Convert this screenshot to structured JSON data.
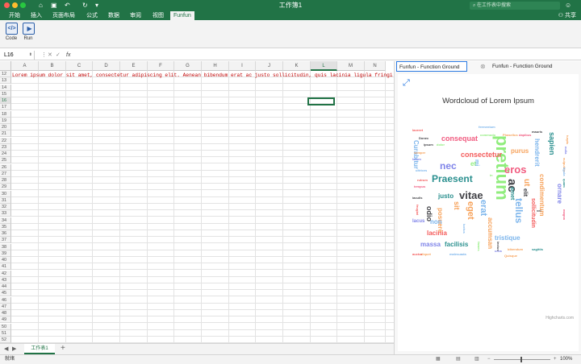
{
  "window": {
    "title": "工作簿1",
    "search_placeholder": "在工作表中搜索"
  },
  "ribbon_tabs": [
    "开始",
    "插入",
    "页面布局",
    "公式",
    "数据",
    "审阅",
    "视图",
    "Funfun"
  ],
  "active_tab": "Funfun",
  "share_label": "共享",
  "ribbon_buttons": [
    {
      "label": "Code"
    },
    {
      "label": "Run"
    }
  ],
  "formula_bar": {
    "name_box": "L16",
    "fx": "fx",
    "content": ""
  },
  "columns": [
    "A",
    "B",
    "C",
    "D",
    "E",
    "F",
    "G",
    "H",
    "I",
    "J",
    "K",
    "L",
    "M",
    "N"
  ],
  "selected_column": "L",
  "rows": [
    "12",
    "13",
    "14",
    "15",
    "16",
    "17",
    "18",
    "19",
    "20",
    "21",
    "22",
    "23",
    "24",
    "25",
    "26",
    "27",
    "28",
    "29",
    "30",
    "31",
    "32",
    "33",
    "34",
    "35",
    "36",
    "37",
    "38",
    "39",
    "40",
    "41",
    "42",
    "43",
    "44",
    "45",
    "46",
    "47",
    "48",
    "49",
    "50",
    "51",
    "52"
  ],
  "selected_row": "16",
  "cell_text": "Lorem ipsum dolor sit amet, consectetur adipiscing elit. Aenean bibendum erat ac justo sollicitudin, quis lacinia ligula fringi",
  "sheet_tab": "工作表1",
  "status": {
    "left": "就绪",
    "zoom": "100%"
  },
  "panel": {
    "tabs": [
      "Funfun - Function Ground",
      "Funfun - Function Ground"
    ],
    "chart_title": "Wordcloud of Lorem Ipsum",
    "credits": "Highcharts.com"
  },
  "words": [
    {
      "t": "pretium",
      "c": "#90ed7d",
      "s": 22,
      "r": 90
    },
    {
      "t": "Praesent",
      "c": "#2b908f",
      "s": 12,
      "r": 0
    },
    {
      "t": "vitae",
      "c": "#434348",
      "s": 13,
      "r": 0
    },
    {
      "t": "eros",
      "c": "#f15c80",
      "s": 13,
      "r": 0
    },
    {
      "t": "ac",
      "c": "#434348",
      "s": 15,
      "r": 90
    },
    {
      "t": "ut",
      "c": "#f7a35c",
      "s": 10,
      "r": 90
    },
    {
      "t": "tellus",
      "c": "#7cb5ec",
      "s": 12,
      "r": 90
    },
    {
      "t": "nec",
      "c": "#8085e9",
      "s": 12,
      "r": 0
    },
    {
      "t": "consectetur",
      "c": "#f45b5b",
      "s": 9,
      "r": 0
    },
    {
      "t": "consequat",
      "c": "#f15c80",
      "s": 9,
      "r": 0
    },
    {
      "t": "sapien",
      "c": "#2b908f",
      "s": 9,
      "r": 90
    },
    {
      "t": "hendrerit",
      "c": "#7cb5ec",
      "s": 8,
      "r": 90
    },
    {
      "t": "purus",
      "c": "#f7a35c",
      "s": 8,
      "r": 0
    },
    {
      "t": "Curabitur",
      "c": "#7cb5ec",
      "s": 8,
      "r": 90
    },
    {
      "t": "condimentum",
      "c": "#f7a35c",
      "s": 8,
      "r": 90
    },
    {
      "t": "ornare",
      "c": "#8085e9",
      "s": 8,
      "r": 90
    },
    {
      "t": "sollicitudin",
      "c": "#f45b5b",
      "s": 7,
      "r": 90
    },
    {
      "t": "elit",
      "c": "#434348",
      "s": 7,
      "r": 90
    },
    {
      "t": "amet",
      "c": "#2b908f",
      "s": 7,
      "r": 90
    },
    {
      "t": "erat",
      "c": "#7cb5ec",
      "s": 11,
      "r": 90
    },
    {
      "t": "eget",
      "c": "#f7a35c",
      "s": 11,
      "r": 90
    },
    {
      "t": "sit",
      "c": "#f7a35c",
      "s": 9,
      "r": 90
    },
    {
      "t": "justo",
      "c": "#2b908f",
      "s": 8,
      "r": 0
    },
    {
      "t": "odio",
      "c": "#434348",
      "s": 9,
      "r": 90
    },
    {
      "t": "posuere",
      "c": "#f7a35c",
      "s": 8,
      "r": 90
    },
    {
      "t": "non",
      "c": "#7cb5ec",
      "s": 8,
      "r": 0
    },
    {
      "t": "lacinia",
      "c": "#f45b5b",
      "s": 8,
      "r": 0
    },
    {
      "t": "massa",
      "c": "#8085e9",
      "s": 8,
      "r": 0
    },
    {
      "t": "facilisis",
      "c": "#2b908f",
      "s": 8,
      "r": 0
    },
    {
      "t": "accumsan",
      "c": "#f7a35c",
      "s": 8,
      "r": 90
    },
    {
      "t": "tristique",
      "c": "#7cb5ec",
      "s": 8,
      "r": 0
    },
    {
      "t": "et",
      "c": "#90ed7d",
      "s": 8,
      "r": 0
    },
    {
      "t": "mi",
      "c": "#7cb5ec",
      "s": 7,
      "r": 90
    },
    {
      "t": "lacus",
      "c": "#8085e9",
      "s": 6,
      "r": 0
    },
    {
      "t": "fermentum",
      "c": "#7cb5ec",
      "s": 4,
      "r": 0
    },
    {
      "t": "commodo",
      "c": "#90ed7d",
      "s": 4,
      "r": 0
    },
    {
      "t": "Phasellus",
      "c": "#f7a35c",
      "s": 4,
      "r": 0
    },
    {
      "t": "dapibus",
      "c": "#f15c80",
      "s": 4,
      "r": 0
    },
    {
      "t": "mauris",
      "c": "#434348",
      "s": 4,
      "r": 0
    },
    {
      "t": "laoreet",
      "c": "#f45b5b",
      "s": 4,
      "r": 0
    },
    {
      "t": "Donec",
      "c": "#434348",
      "s": 4,
      "r": 0
    },
    {
      "t": "ipsum",
      "c": "#434348",
      "s": 4,
      "r": 0
    },
    {
      "t": "dolor",
      "c": "#90ed7d",
      "s": 4,
      "r": 0
    },
    {
      "t": "semper",
      "c": "#f7a35c",
      "s": 4,
      "r": 0
    },
    {
      "t": "lorem",
      "c": "#8085e9",
      "s": 4,
      "r": 0
    },
    {
      "t": "ultrices",
      "c": "#7cb5ec",
      "s": 4,
      "r": 0
    },
    {
      "t": "rutrum",
      "c": "#f45b5b",
      "s": 4,
      "r": 0
    },
    {
      "t": "tempus",
      "c": "#f15c80",
      "s": 4,
      "r": 0
    },
    {
      "t": "iaculis",
      "c": "#434348",
      "s": 4,
      "r": 0
    },
    {
      "t": "aliquet",
      "c": "#f7a35c",
      "s": 4,
      "r": 0
    },
    {
      "t": "auctor",
      "c": "#f45b5b",
      "s": 4,
      "r": 0
    },
    {
      "t": "malesuada",
      "c": "#7cb5ec",
      "s": 4,
      "r": 0
    },
    {
      "t": "Quisque",
      "c": "#f7a35c",
      "s": 4,
      "r": 0
    },
    {
      "t": "sagittis",
      "c": "#2b908f",
      "s": 4,
      "r": 0
    },
    {
      "t": "urna",
      "c": "#8085e9",
      "s": 4,
      "r": 0
    },
    {
      "t": "bibendum",
      "c": "#f7a35c",
      "s": 4,
      "r": 0
    },
    {
      "t": "lectus",
      "c": "#434348",
      "s": 4,
      "r": 90
    },
    {
      "t": "fames",
      "c": "#90ed7d",
      "s": 4,
      "r": 90
    },
    {
      "t": "luctus",
      "c": "#7cb5ec",
      "s": 4,
      "r": 90
    },
    {
      "t": "feugiat",
      "c": "#f45b5b",
      "s": 4,
      "r": 90
    },
    {
      "t": "turpis",
      "c": "#f7a35c",
      "s": 4,
      "r": 90
    },
    {
      "t": "nulla",
      "c": "#8085e9",
      "s": 4,
      "r": 90
    },
    {
      "t": "vulputate",
      "c": "#f7a35c",
      "s": 4,
      "r": 90
    },
    {
      "t": "ligula",
      "c": "#7cb5ec",
      "s": 4,
      "r": 90
    },
    {
      "t": "quam",
      "c": "#2b908f",
      "s": 4,
      "r": 90
    },
    {
      "t": "magna",
      "c": "#f15c80",
      "s": 4,
      "r": 90
    },
    {
      "t": "vel",
      "c": "#434348",
      "s": 4,
      "r": 0
    },
    {
      "t": "in",
      "c": "#90ed7d",
      "s": 4,
      "r": 0
    }
  ]
}
